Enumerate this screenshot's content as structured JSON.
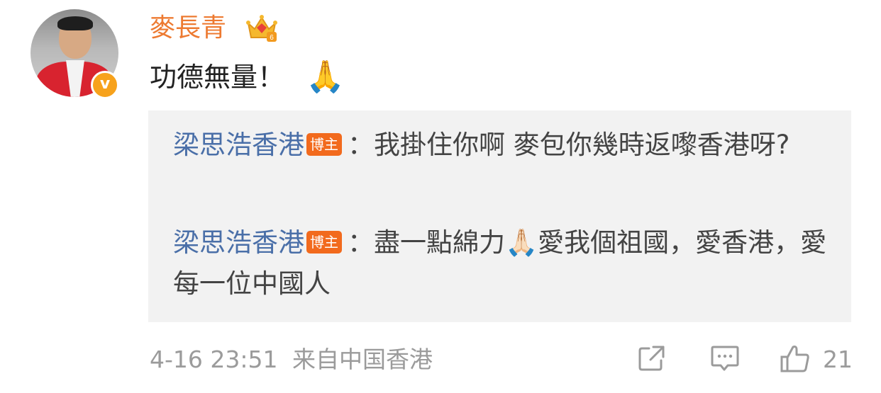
{
  "post": {
    "username": "麥長青",
    "comment_text": "功德無量！",
    "comment_emoji": "🙏"
  },
  "replies": [
    {
      "author": "梁思浩香港",
      "badge": "博主",
      "separator": "：",
      "text": "我掛住你啊 麥包你幾時返嚟香港呀?"
    },
    {
      "author": "梁思浩香港",
      "badge": "博主",
      "separator": "：",
      "text_before_emoji": "盡一點綿力",
      "emoji": "🙏🏻",
      "text_after_emoji": "愛我個祖國，愛香港，愛每一位中國人"
    }
  ],
  "footer": {
    "timestamp": "4-16 23:51",
    "source": "来自中国香港",
    "like_count": "21"
  },
  "icons": {
    "verified": "verified-badge-icon",
    "crown": "vip-crown-icon",
    "share": "share-icon",
    "comment": "comment-icon",
    "like": "thumbs-up-icon"
  },
  "colors": {
    "username": "#ed7a31",
    "reply_author": "#4a6fa8",
    "badge_bg": "#f26a1d",
    "verified": "#f7a21c",
    "reply_bg": "#f2f2f2"
  }
}
